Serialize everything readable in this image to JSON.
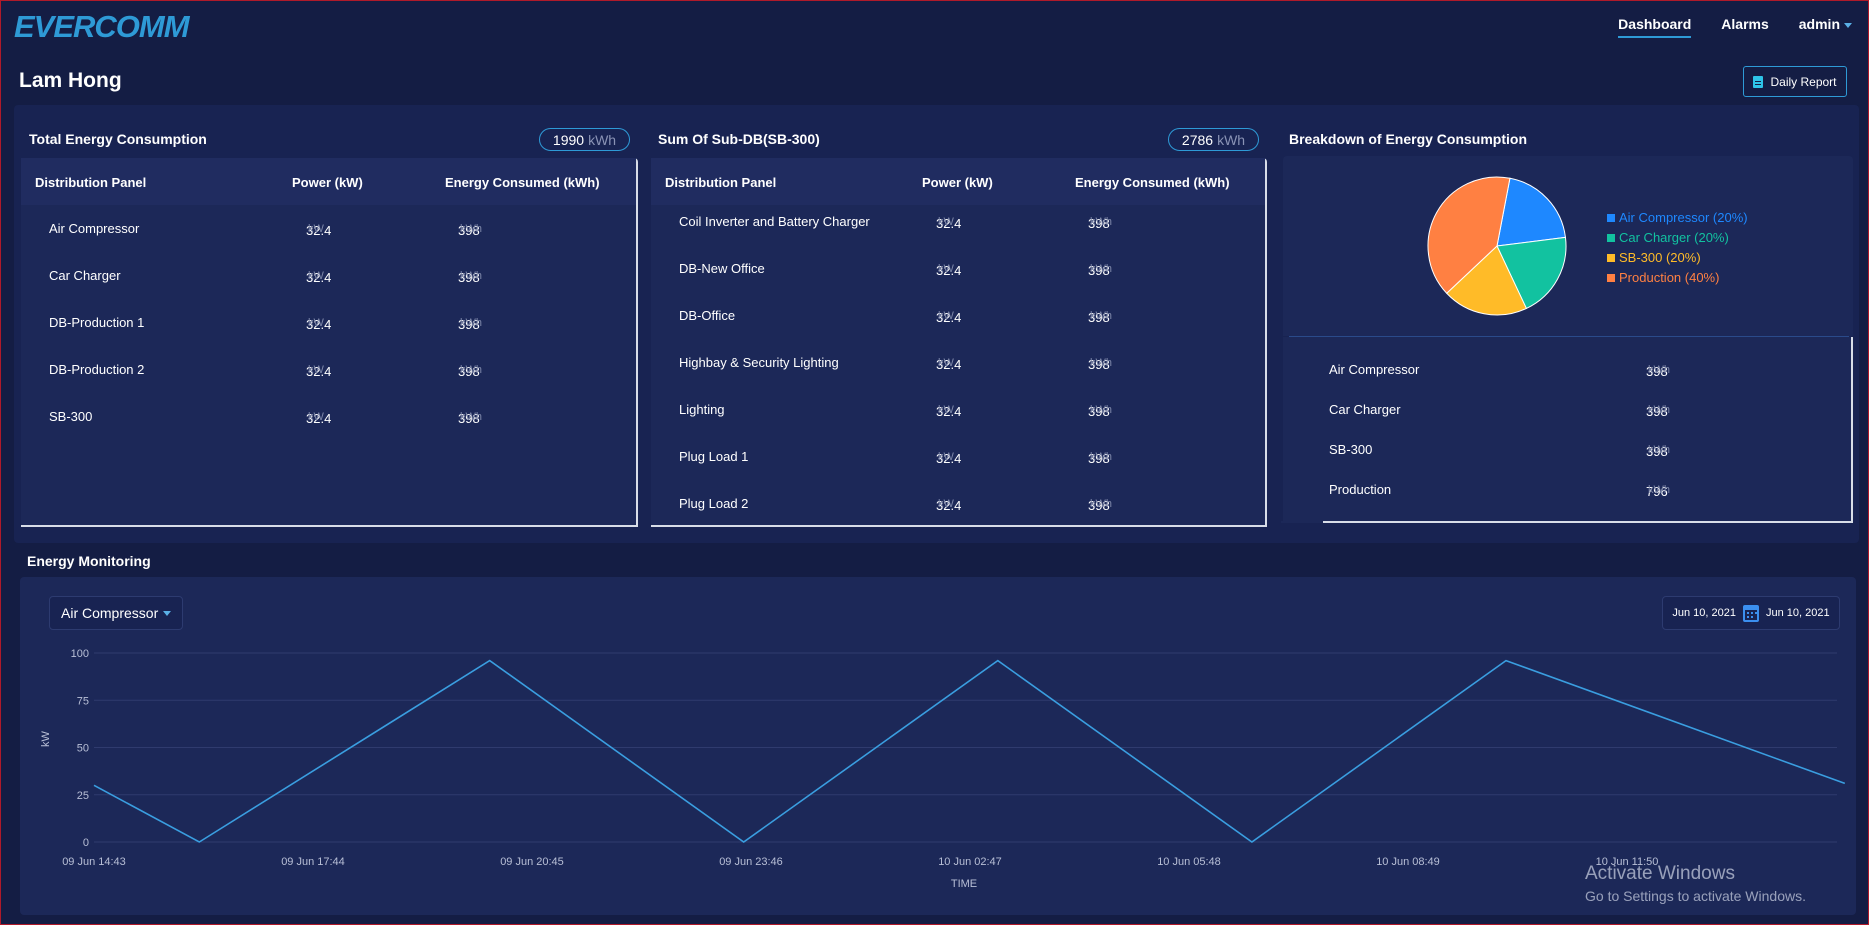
{
  "header": {
    "logo": "EVERCOMM",
    "nav": [
      {
        "label": "Dashboard",
        "active": true
      },
      {
        "label": "Alarms",
        "active": false
      },
      {
        "label": "admin",
        "active": false
      }
    ]
  },
  "page": {
    "title": "Lam Hong",
    "report_button": "Daily Report"
  },
  "total": {
    "title": "Total Energy Consumption",
    "value": "1990",
    "unit": "kWh",
    "columns": [
      "Distribution Panel",
      "Power (kW)",
      "Energy Consumed (kWh)"
    ],
    "rows": [
      {
        "name": "Air Compressor",
        "power": "32.4",
        "energy": "398"
      },
      {
        "name": "Car Charger",
        "power": "32.4",
        "energy": "398"
      },
      {
        "name": "DB-Production 1",
        "power": "32.4",
        "energy": "398"
      },
      {
        "name": "DB-Production 2",
        "power": "32.4",
        "energy": "398"
      },
      {
        "name": "SB-300",
        "power": "32.4",
        "energy": "398"
      }
    ]
  },
  "subdb": {
    "title": "Sum Of Sub-DB(SB-300)",
    "value": "2786",
    "unit": "kWh",
    "columns": [
      "Distribution Panel",
      "Power (kW)",
      "Energy Consumed (kWh)"
    ],
    "rows": [
      {
        "name": "Coil Inverter and Battery Charger",
        "power": "32.4",
        "energy": "398"
      },
      {
        "name": "DB-New Office",
        "power": "32.4",
        "energy": "398"
      },
      {
        "name": "DB-Office",
        "power": "32.4",
        "energy": "398"
      },
      {
        "name": "Highbay & Security Lighting",
        "power": "32.4",
        "energy": "398"
      },
      {
        "name": "Lighting",
        "power": "32.4",
        "energy": "398"
      },
      {
        "name": "Plug Load 1",
        "power": "32.4",
        "energy": "398"
      },
      {
        "name": "Plug Load 2",
        "power": "32.4",
        "energy": "398"
      }
    ]
  },
  "units": {
    "power": "kW",
    "energy": "kWh"
  },
  "breakdown": {
    "title": "Breakdown of Energy Consumption",
    "legend": [
      {
        "label": "Air Compressor (20%)",
        "color": "#1e88ff"
      },
      {
        "label": "Car Charger (20%)",
        "color": "#12c2a0"
      },
      {
        "label": "SB-300 (20%)",
        "color": "#ffbb28"
      },
      {
        "label": "Production (40%)",
        "color": "#ff8042"
      }
    ],
    "rows": [
      {
        "name": "Air Compressor",
        "energy": "398"
      },
      {
        "name": "Car Charger",
        "energy": "398"
      },
      {
        "name": "SB-300",
        "energy": "398"
      },
      {
        "name": "Production",
        "energy": "796"
      }
    ]
  },
  "monitoring": {
    "title": "Energy Monitoring",
    "selected_panel": "Air Compressor",
    "date_from": "Jun 10, 2021",
    "date_to": "Jun 10, 2021"
  },
  "chart_data": [
    {
      "type": "pie",
      "labels": [
        "Air Compressor",
        "Car Charger",
        "SB-300",
        "Production"
      ],
      "values": [
        20,
        20,
        20,
        40
      ],
      "colors": [
        "#1e88ff",
        "#12c2a0",
        "#ffbb28",
        "#ff8042"
      ]
    },
    {
      "type": "line",
      "xlabel": "TIME",
      "ylabel": "kW",
      "ylim": [
        0,
        100
      ],
      "yticks": [
        "100",
        "75",
        "50",
        "25",
        "0"
      ],
      "xticks": [
        "09 Jun 14:43",
        "09 Jun 17:44",
        "09 Jun 20:45",
        "09 Jun 23:46",
        "10 Jun 02:47",
        "10 Jun 05:48",
        "10 Jun 08:49",
        "10 Jun 11:50"
      ],
      "x": [
        "09 Jun 14:43",
        "09 Jun 16:10",
        "09 Jun 20:10",
        "09 Jun 23:40",
        "10 Jun 03:10",
        "10 Jun 06:40",
        "10 Jun 10:10",
        "10 Jun 14:50"
      ],
      "values": [
        30,
        0,
        96,
        0,
        96,
        0,
        96,
        31
      ],
      "color": "#3a9ee0",
      "grid": true
    }
  ],
  "watermark": {
    "line1": "Activate Windows",
    "line2": "Go to Settings to activate Windows."
  }
}
